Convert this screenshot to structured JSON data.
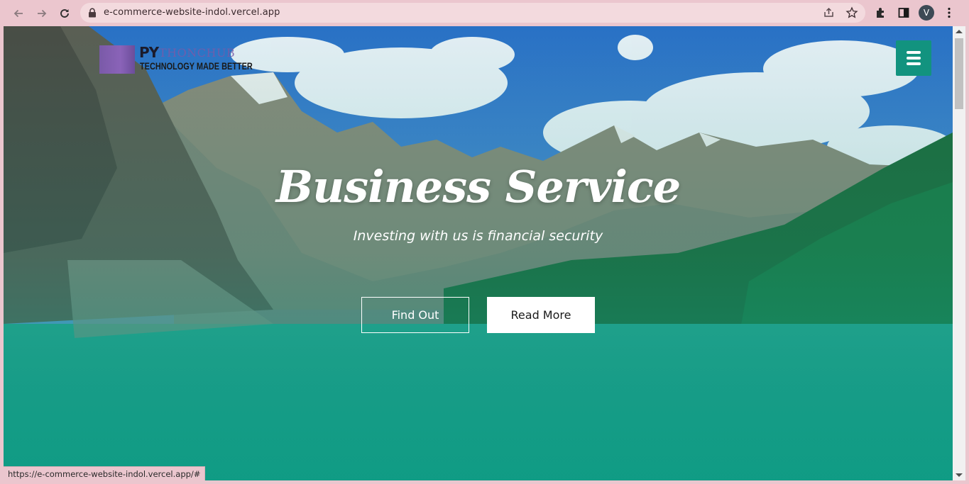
{
  "browser": {
    "url": "e-commerce-website-indol.vercel.app",
    "status_url": "https://e-commerce-website-indol.vercel.app/#",
    "avatar_letter": "V",
    "icons": [
      "back-icon",
      "forward-icon",
      "reload-icon",
      "lock-icon",
      "share-icon",
      "star-icon",
      "extensions-icon",
      "sidepanel-icon",
      "kebab-menu-icon"
    ]
  },
  "site": {
    "logo": {
      "brand_prefix": "PY",
      "brand_suffix": "THONCHUB",
      "tagline": "TECHNOLOGY MADE BETTER"
    },
    "hero": {
      "title": "Business Service",
      "subtitle": "Investing with us is financial security",
      "buttons": {
        "find_out": "Find Out",
        "read_more": "Read More"
      }
    },
    "colors": {
      "accent": "#12937f",
      "overlay_teal": "#14a58c"
    }
  }
}
